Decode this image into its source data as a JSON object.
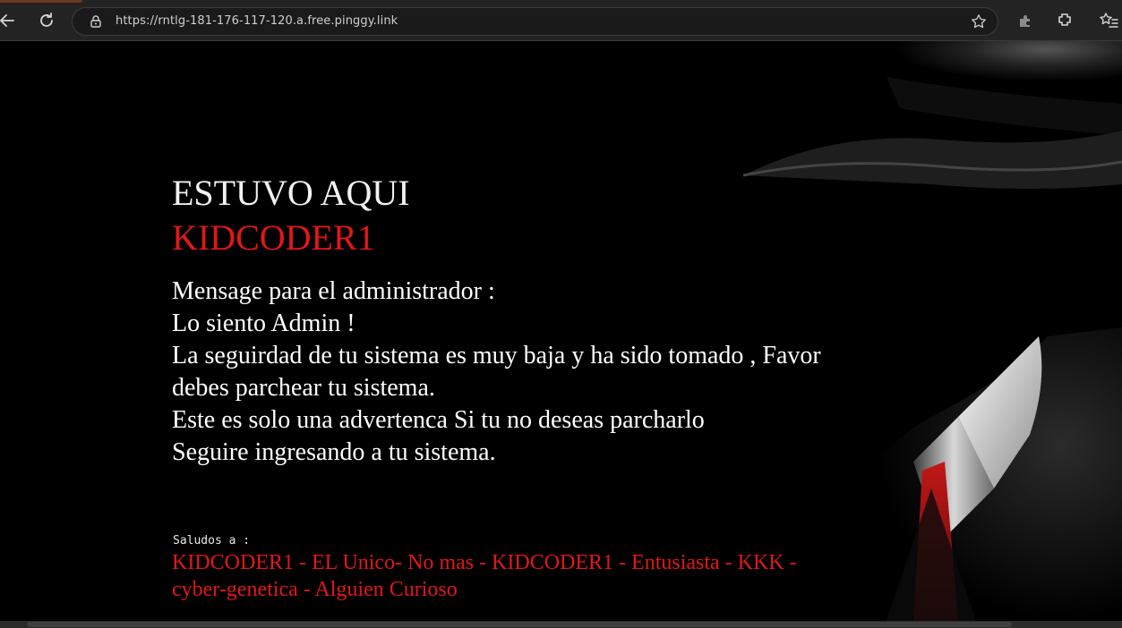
{
  "browser": {
    "url": "https://rntlg-181-176-117-120.a.free.pinggy.link",
    "icons": [
      "back-icon",
      "reload-icon",
      "lock-icon",
      "star-icon",
      "extension-puzzle-icon",
      "favorites-icon",
      "profile-icon"
    ]
  },
  "page": {
    "headline": "ESTUVO AQUI",
    "author": "KIDCODER1",
    "message_lines": [
      "Mensage para el administrador :",
      "Lo siento Admin !",
      "La seguirdad de tu sistema es muy baja y ha sido tomado , Favor",
      "debes parchear tu sistema.",
      "Este es solo una advertenca Si tu no deseas parcharlo",
      "Seguire ingresando a tu sistema."
    ],
    "greetings_label": "Saludos a :",
    "greetings_lines": [
      "KIDCODER1 - EL Unico- No mas - KIDCODER1 - Entusiasta - KKK -",
      "cyber-genetica - Alguien Curioso"
    ]
  },
  "colors": {
    "background": "#000000",
    "accent_red": "#e21717",
    "text_white": "#ffffff"
  }
}
